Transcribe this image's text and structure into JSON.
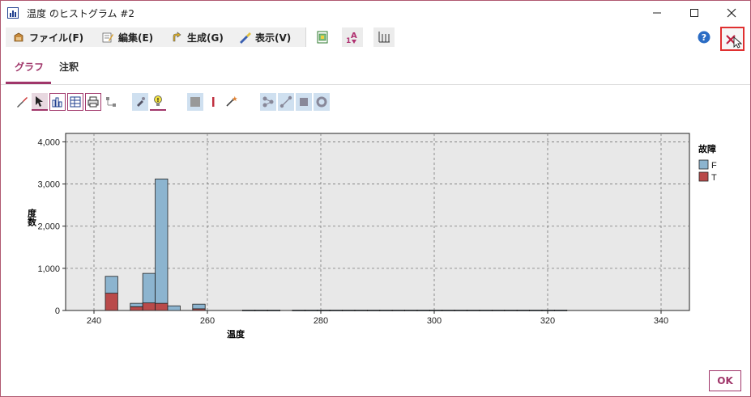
{
  "window": {
    "title": "温度 のヒストグラム #2"
  },
  "menu": [
    {
      "label": "ファイル(F)",
      "icon": "file-icon"
    },
    {
      "label": "編集(E)",
      "icon": "edit-icon"
    },
    {
      "label": "生成(G)",
      "icon": "generate-icon"
    },
    {
      "label": "表示(V)",
      "icon": "view-icon"
    }
  ],
  "tabs": [
    {
      "label": "グラフ",
      "active": true
    },
    {
      "label": "注釈",
      "active": false
    }
  ],
  "ok_label": "OK",
  "colors": {
    "accent": "#a0366a",
    "series_F": "#8cb4cf",
    "series_T": "#b94a4a",
    "plot_bg": "#e8e8e8"
  },
  "chart_data": {
    "type": "bar",
    "xlabel": "温度",
    "ylabel": "度数",
    "xlim": [
      235,
      345
    ],
    "ylim": [
      0,
      4200
    ],
    "xticks": [
      "240",
      "260",
      "280",
      "300",
      "320",
      "340"
    ],
    "yticks": [
      "0",
      "1,000",
      "2,000",
      "3,000",
      "4,000"
    ],
    "grid": true,
    "legend_title": "故障",
    "legend_position": "right",
    "bin_width": 2.2,
    "bins": [
      242.0,
      244.2,
      246.4,
      248.6,
      250.8,
      253.0,
      255.2,
      257.4,
      259.6,
      261.8,
      264.0,
      266.2,
      268.4,
      270.6,
      272.8,
      275.0,
      277.2,
      279.4,
      281.6,
      283.8,
      286.0,
      288.2,
      290.4,
      292.6,
      294.8,
      297.0,
      299.2,
      301.4,
      303.6,
      305.8,
      308.0,
      310.2,
      312.4,
      314.6,
      316.8,
      319.0,
      321.2
    ],
    "series": [
      {
        "name": "F",
        "values": [
          400,
          0,
          80,
          700,
          2950,
          110,
          0,
          110,
          0,
          0,
          0,
          10,
          10,
          10,
          0,
          10,
          10,
          10,
          10,
          10,
          10,
          10,
          10,
          10,
          10,
          10,
          10,
          10,
          10,
          10,
          10,
          10,
          10,
          10,
          10,
          10,
          10
        ]
      },
      {
        "name": "T",
        "values": [
          410,
          0,
          90,
          180,
          170,
          0,
          0,
          40,
          0,
          0,
          0,
          0,
          0,
          0,
          0,
          0,
          0,
          0,
          0,
          0,
          0,
          0,
          0,
          0,
          0,
          0,
          0,
          0,
          0,
          0,
          0,
          0,
          0,
          0,
          0,
          0,
          0
        ]
      }
    ]
  }
}
